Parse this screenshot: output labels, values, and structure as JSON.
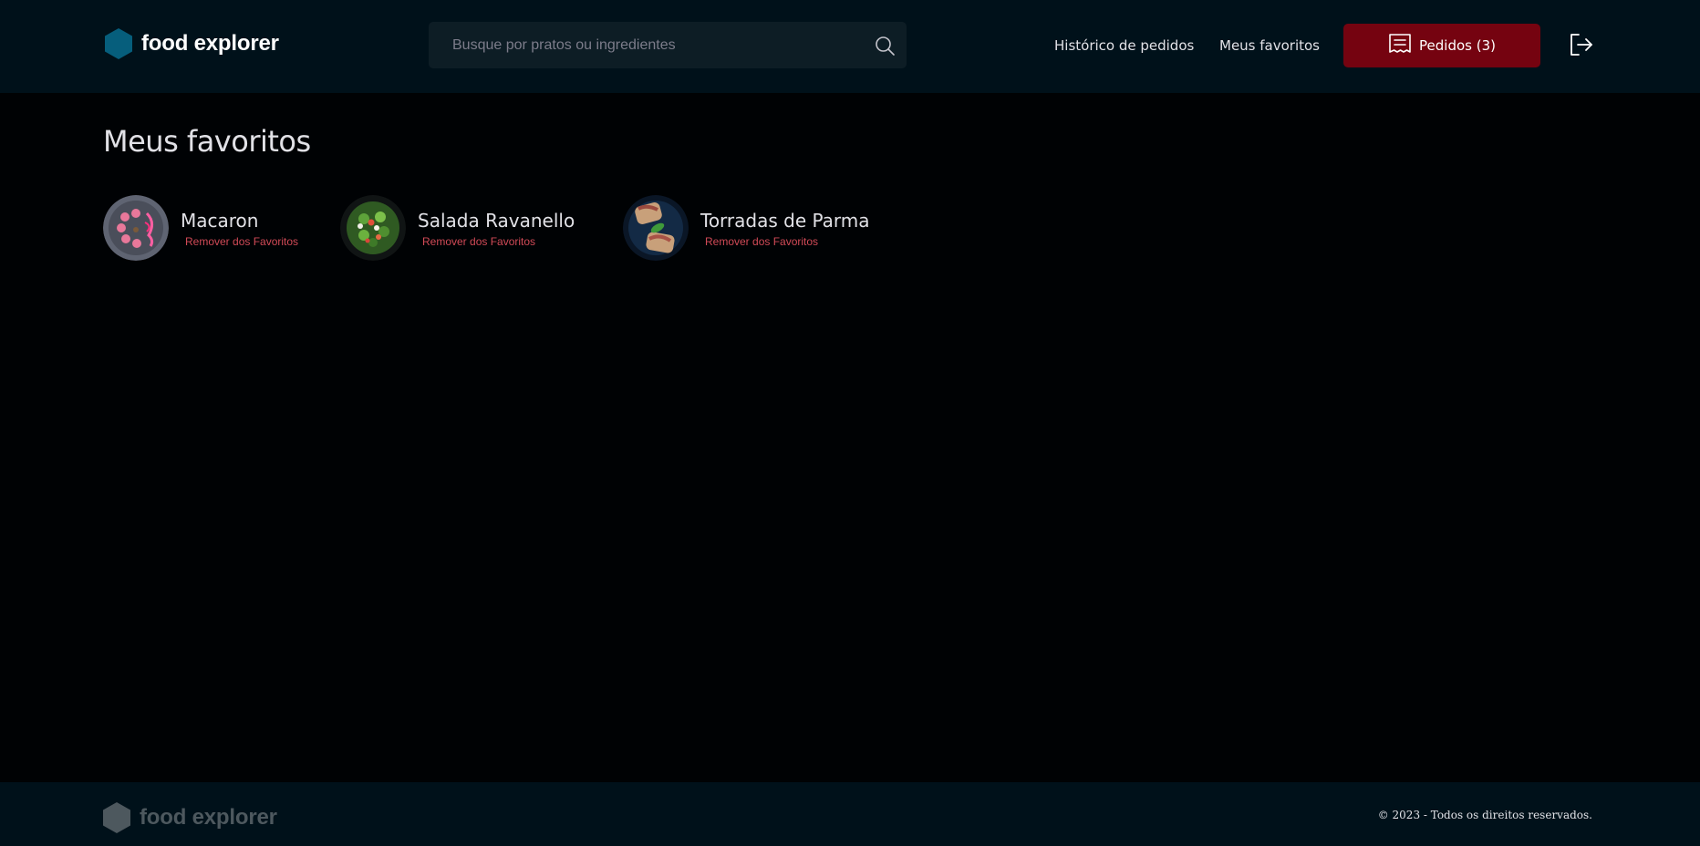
{
  "header": {
    "brand_name": "food explorer",
    "search_placeholder": "Busque por pratos ou ingredientes",
    "nav": {
      "history_label": "Histórico de pedidos",
      "favorites_label": "Meus favoritos"
    },
    "orders_label": "Pedidos (3)",
    "icons": {
      "logo": "hexagon-logo-icon",
      "search": "search-icon",
      "orders": "receipt-icon",
      "logout": "sign-out-icon"
    },
    "colors": {
      "accent": "#750310",
      "logo": "#065e7c"
    }
  },
  "main": {
    "title": "Meus favoritos",
    "favorites": [
      {
        "name": "Macaron",
        "action": "Remover dos Favoritos"
      },
      {
        "name": "Salada Ravanello",
        "action": "Remover dos Favoritos"
      },
      {
        "name": "Torradas de Parma",
        "action": "Remover dos Favoritos"
      }
    ]
  },
  "footer": {
    "brand_name": "food explorer",
    "copyright": "© 2023 - Todos os direitos reservados."
  }
}
